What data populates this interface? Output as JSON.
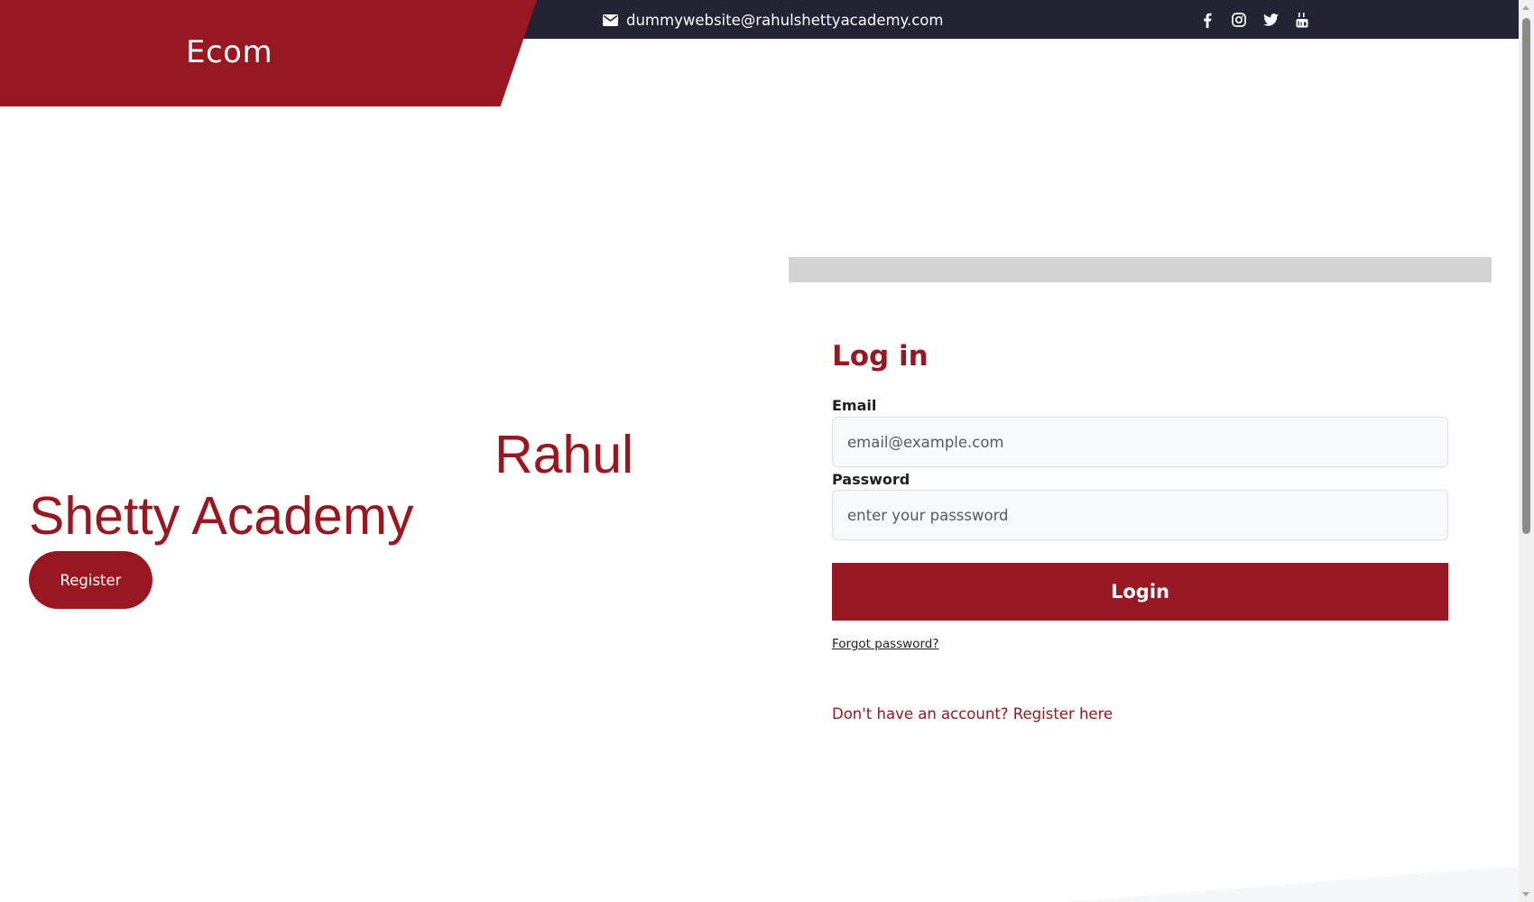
{
  "header": {
    "brand": "Ecom",
    "email": "dummywebsite@rahulshettyacademy.com",
    "social": [
      "facebook-icon",
      "instagram-icon",
      "twitter-icon",
      "youtube-icon"
    ],
    "brand_color": "#981720",
    "topbar_color": "#232334"
  },
  "hero": {
    "line1": "Rahul",
    "line2": "Shetty Academy",
    "register_label": "Register"
  },
  "login": {
    "title": "Log in",
    "email_label": "Email",
    "email_placeholder": "email@example.com",
    "password_label": "Password",
    "password_placeholder": "enter your passsword",
    "login_label": "Login",
    "forgot_label": "Forgot password?",
    "signup_label": "Don't have an account? Register here"
  }
}
